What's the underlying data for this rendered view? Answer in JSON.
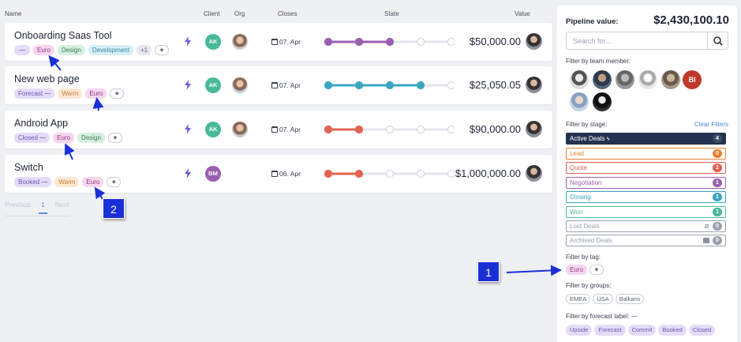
{
  "columns": {
    "name": "Name",
    "client": "Client",
    "org": "Org",
    "closes": "Closes",
    "state": "State",
    "value": "Value"
  },
  "deals": [
    {
      "title": "Onboarding Saas Tool",
      "tags": [
        "Euro",
        "Design",
        "Development"
      ],
      "more": "+1",
      "forecast": "",
      "client": "AK",
      "client_color": "#49b99a",
      "date": "07. Apr",
      "amount": "$50,000.00",
      "stage_color": "#9a5fb0",
      "filled_steps": 3
    },
    {
      "title": "New web page",
      "forecast": "Forecast",
      "tags": [
        "Warm",
        "Euro"
      ],
      "client": "AK",
      "client_color": "#49b99a",
      "date": "07. Apr",
      "amount": "$25,050.05",
      "stage_color": "#3ba6bf",
      "filled_steps": 4
    },
    {
      "title": "Android App",
      "forecast": "Closed",
      "tags": [
        "Euro",
        "Design"
      ],
      "client": "AK",
      "client_color": "#49b99a",
      "date": "07. Apr",
      "amount": "$90,000.00",
      "stage_color": "#e06452",
      "filled_steps": 2
    },
    {
      "title": "Switch",
      "forecast": "Booked",
      "tags": [
        "Warm",
        "Euro"
      ],
      "client": "BM",
      "client_color": "#9a5fb0",
      "date": "06. Apr",
      "amount": "$1,000,000.00",
      "stage_color": "#e06452",
      "filled_steps": 2
    }
  ],
  "pager": {
    "previous": "Previous",
    "page": "1",
    "next": "Next"
  },
  "annotations": {
    "one": "1",
    "two": "2"
  },
  "sidebar": {
    "pipeline_label": "Pipeline value:",
    "pipeline_value": "$2,430,100.10",
    "search_placeholder": "Search for...",
    "team_label": "Filter by team member:",
    "team_initials": "BI",
    "stage_label": "Filter by stage:",
    "clear_label": "Clear Filters",
    "stages": [
      {
        "label": "Active Deals",
        "count": "4",
        "color": "#24324f"
      },
      {
        "label": "Lead",
        "count": "0",
        "color": "#e8802f"
      },
      {
        "label": "Quote",
        "count": "2",
        "color": "#e0604f"
      },
      {
        "label": "Negotiation",
        "count": "1",
        "color": "#9a5fb0"
      },
      {
        "label": "Closing",
        "count": "1",
        "color": "#3ba6bf"
      },
      {
        "label": "Won",
        "count": "1",
        "color": "#49b99a"
      },
      {
        "label": "Lost Deals",
        "count": "0",
        "color": "#9aa1ad"
      },
      {
        "label": "Archived Deals",
        "count": "0",
        "color": "#9aa1ad"
      }
    ],
    "tag_label": "Filter by tag:",
    "tag": "Euro",
    "groups_label": "Filter by groups:",
    "groups": [
      "EMEA",
      "USA",
      "Balkans"
    ],
    "forecast_label": "Filter by forecast label:",
    "forecasts": [
      "Upside",
      "Forecast",
      "Commit",
      "Booked",
      "Closed"
    ]
  }
}
